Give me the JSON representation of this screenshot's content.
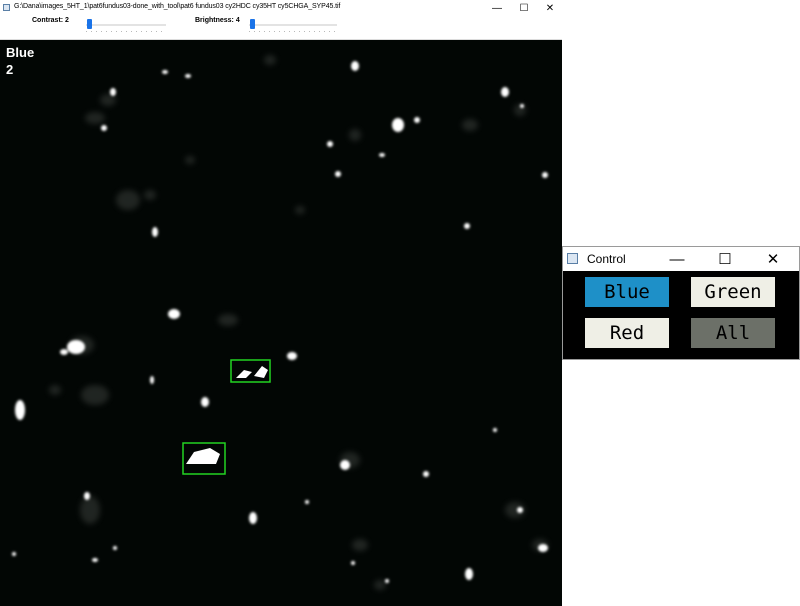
{
  "main_window": {
    "title": "G:\\Dana\\images_5HT_1\\pat6fundus03-done_with_tool\\pat6 fundus03 cy2HDC cy35HT cy5CHGA_SYP45.tif",
    "controls": {
      "minimize": "—",
      "maximize": "☐",
      "close": "✕"
    }
  },
  "toolbar": {
    "contrast": {
      "label": "Contrast: 2",
      "value": 2
    },
    "brightness": {
      "label": "Brightness: 4",
      "value": 4
    }
  },
  "canvas": {
    "channel_label": "Blue",
    "channel_value": "2",
    "background_color": "#020604",
    "box_color": "#22d422",
    "detection_boxes": 2
  },
  "control_window": {
    "title": "Control",
    "controls": {
      "minimize": "—",
      "maximize": "☐",
      "close": "✕"
    },
    "buttons": {
      "blue": "Blue",
      "green": "Green",
      "red": "Red",
      "all": "All"
    },
    "active_channel": "Blue"
  },
  "colors": {
    "active_button": "#1e90c8",
    "inactive_button": "#efefe6",
    "all_button": "#6c7068",
    "slider_thumb": "#1a73e8"
  }
}
